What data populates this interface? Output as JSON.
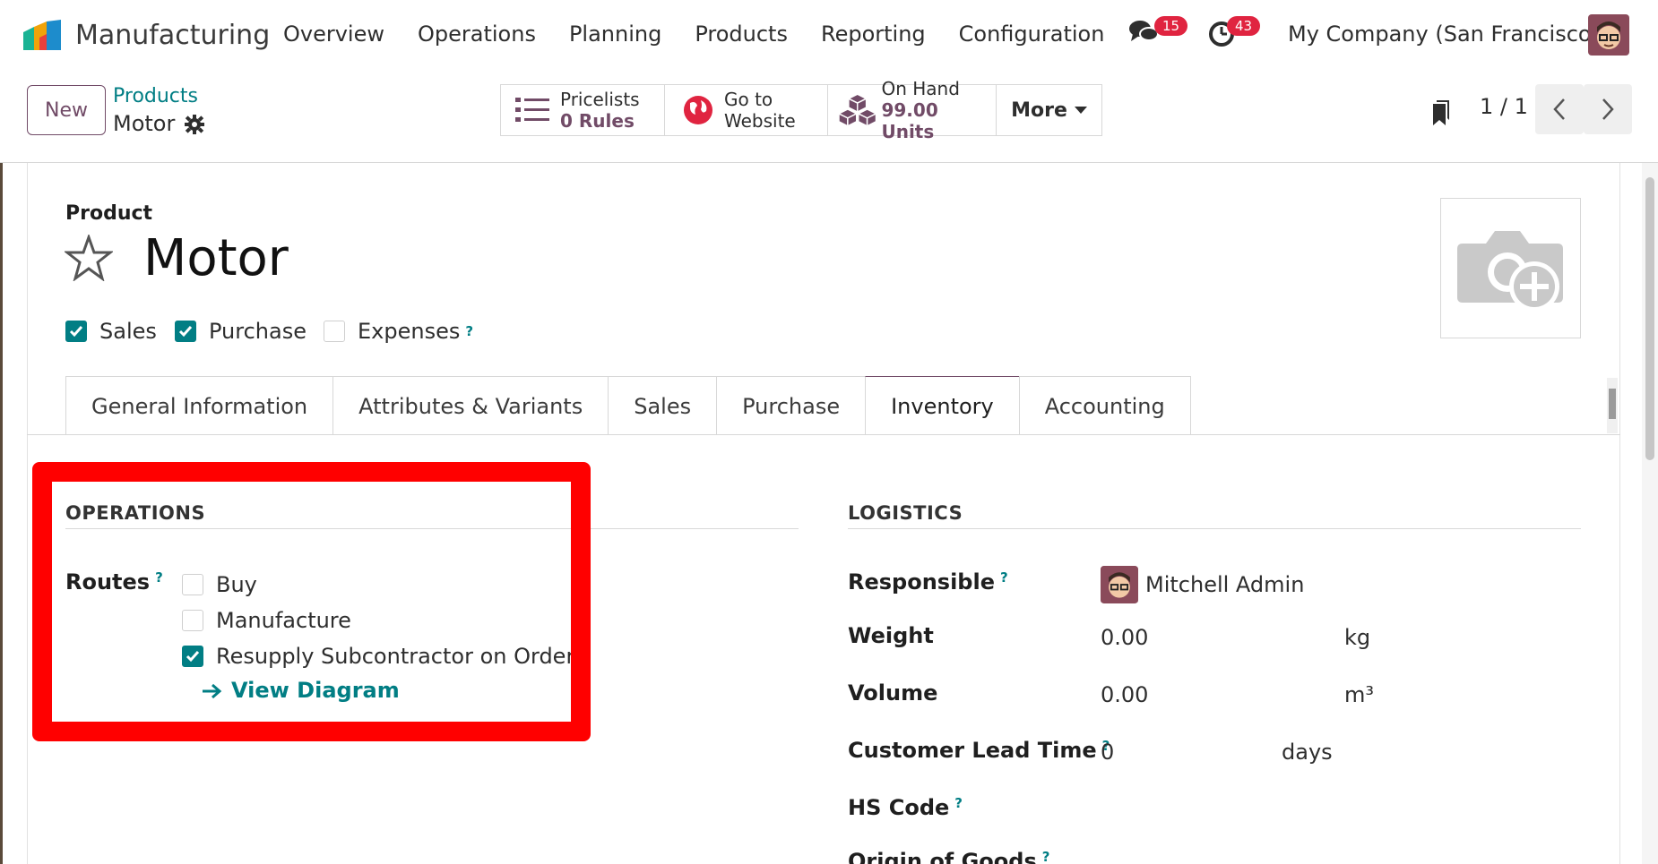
{
  "topbar": {
    "app_name": "Manufacturing",
    "menu": [
      "Overview",
      "Operations",
      "Planning",
      "Products",
      "Reporting",
      "Configuration"
    ],
    "messages_count": "15",
    "activities_count": "43",
    "company": "My Company (San Francisco)"
  },
  "control": {
    "new_label": "New",
    "breadcrumb_parent": "Products",
    "breadcrumb_current": "Motor",
    "smart_buttons": {
      "pricelists_label": "Pricelists",
      "pricelists_value": "0 Rules",
      "website_line1": "Go to",
      "website_line2": "Website",
      "onhand_label": "On Hand",
      "onhand_value": "99.00 Units",
      "more_label": "More"
    },
    "pager": "1 / 1"
  },
  "form": {
    "product_label": "Product",
    "name": "Motor",
    "flags": {
      "sales": {
        "label": "Sales",
        "checked": true
      },
      "purchase": {
        "label": "Purchase",
        "checked": true
      },
      "expenses": {
        "label": "Expenses",
        "checked": false
      }
    },
    "help_mark": "?",
    "tabs": [
      "General Information",
      "Attributes & Variants",
      "Sales",
      "Purchase",
      "Inventory",
      "Accounting"
    ],
    "active_tab": "Inventory",
    "operations": {
      "title": "OPERATIONS",
      "routes_label": "Routes",
      "routes": [
        {
          "label": "Buy",
          "checked": false
        },
        {
          "label": "Manufacture",
          "checked": false
        },
        {
          "label": "Resupply Subcontractor on Order",
          "checked": true
        }
      ],
      "view_diagram": "View Diagram"
    },
    "logistics": {
      "title": "LOGISTICS",
      "responsible_label": "Responsible",
      "responsible_value": "Mitchell Admin",
      "weight_label": "Weight",
      "weight_value": "0.00",
      "weight_unit": "kg",
      "volume_label": "Volume",
      "volume_value": "0.00",
      "volume_unit": "m³",
      "lead_time_label": "Customer Lead Time",
      "lead_time_value": "0",
      "lead_time_unit": "days",
      "hs_code_label": "HS Code",
      "origin_label": "Origin of Goods"
    }
  },
  "colors": {
    "brand": "#714b67",
    "accent": "#017e84",
    "badge": "#e02440",
    "highlight": "#ff0000"
  }
}
